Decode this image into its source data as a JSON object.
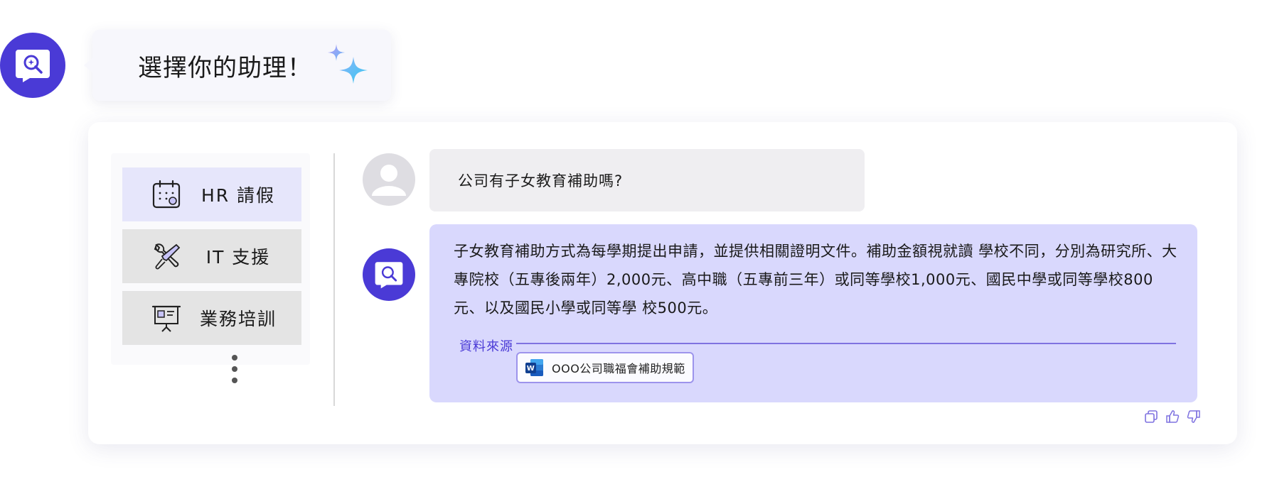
{
  "header": {
    "title": "選擇你的助理！",
    "avatar_icon": "assistant-chat-icon",
    "sparkle_icon": "sparkle-icon"
  },
  "assistants": {
    "items": [
      {
        "label": "HR 請假",
        "icon": "calendar-icon",
        "active": true
      },
      {
        "label": "IT 支援",
        "icon": "wrench-screwdriver-icon",
        "active": false
      },
      {
        "label": "業務培訓",
        "icon": "presentation-board-icon",
        "active": false
      }
    ],
    "more_icon": "more-vertical-icon"
  },
  "chat": {
    "user_message": "公司有子女教育補助嗎?",
    "bot_answer": "子女教育補助方式為每學期提出申請，並提供相關證明文件。補助金額視就讀 學校不同，分別為研究所、大專院校（五專後兩年）2,000元、高中職（五專前三年）或同等學校1,000元、國民中學或同等學校800元、以及國民小學或同等學 校500元。",
    "source_label": "資料來源",
    "source_doc": "OOO公司職福會補助規範",
    "source_icon": "word-document-icon"
  },
  "colors": {
    "brand": "#4a3ad6",
    "bot_bubble": "#d9d8fd",
    "active_item": "#e6e6fb"
  }
}
